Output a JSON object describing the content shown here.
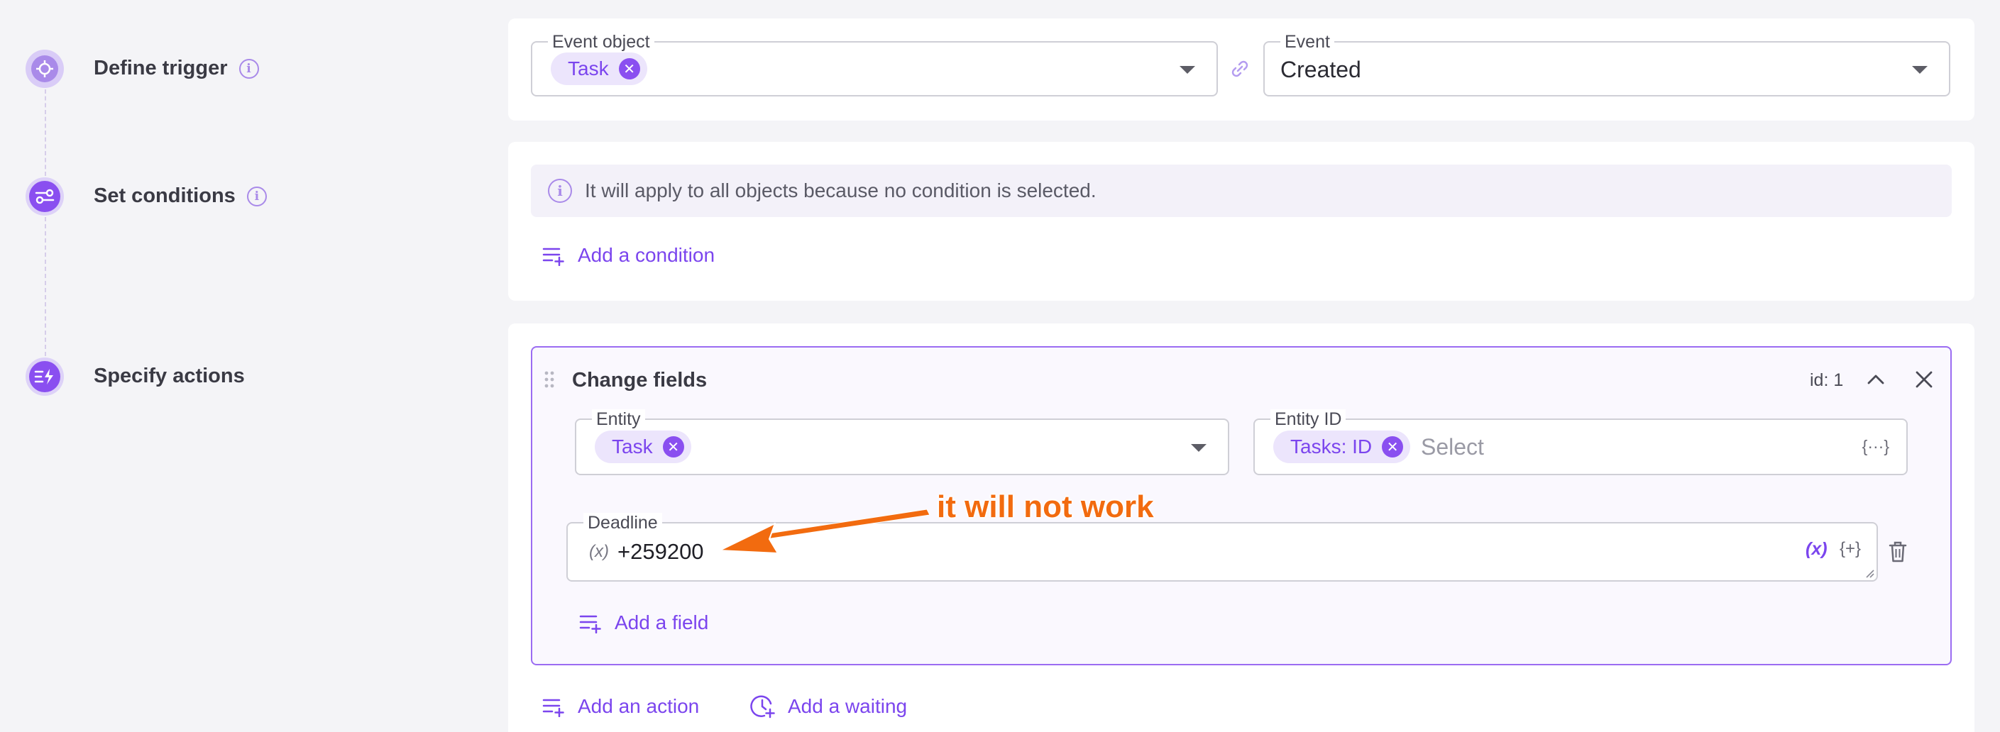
{
  "steps": [
    {
      "label": "Define trigger"
    },
    {
      "label": "Set conditions"
    },
    {
      "label": "Specify actions"
    }
  ],
  "trigger": {
    "event_object_legend": "Event object",
    "event_object_chip": "Task",
    "event_legend": "Event",
    "event_value": "Created"
  },
  "conditions": {
    "banner_text": "It will apply to all objects because no condition is selected.",
    "add_condition_label": "Add a condition"
  },
  "action": {
    "title": "Change fields",
    "id_label": "id: 1",
    "entity_legend": "Entity",
    "entity_chip": "Task",
    "entity_id_legend": "Entity ID",
    "entity_id_chip": "Tasks: ID",
    "entity_id_placeholder": "Select",
    "deadline_legend": "Deadline",
    "deadline_var_icon": "(x)",
    "deadline_value": "+259200",
    "var_button": "(x)",
    "func_button": "{+}",
    "code_button": "{···}",
    "add_field_label": "Add a field"
  },
  "footer": {
    "add_action_label": "Add an action",
    "add_waiting_label": "Add a waiting"
  },
  "annotation": {
    "text": "it will not work",
    "color": "#f26b0f"
  },
  "colors": {
    "accent": "#8a4ff0",
    "background": "#f4f4f7"
  }
}
